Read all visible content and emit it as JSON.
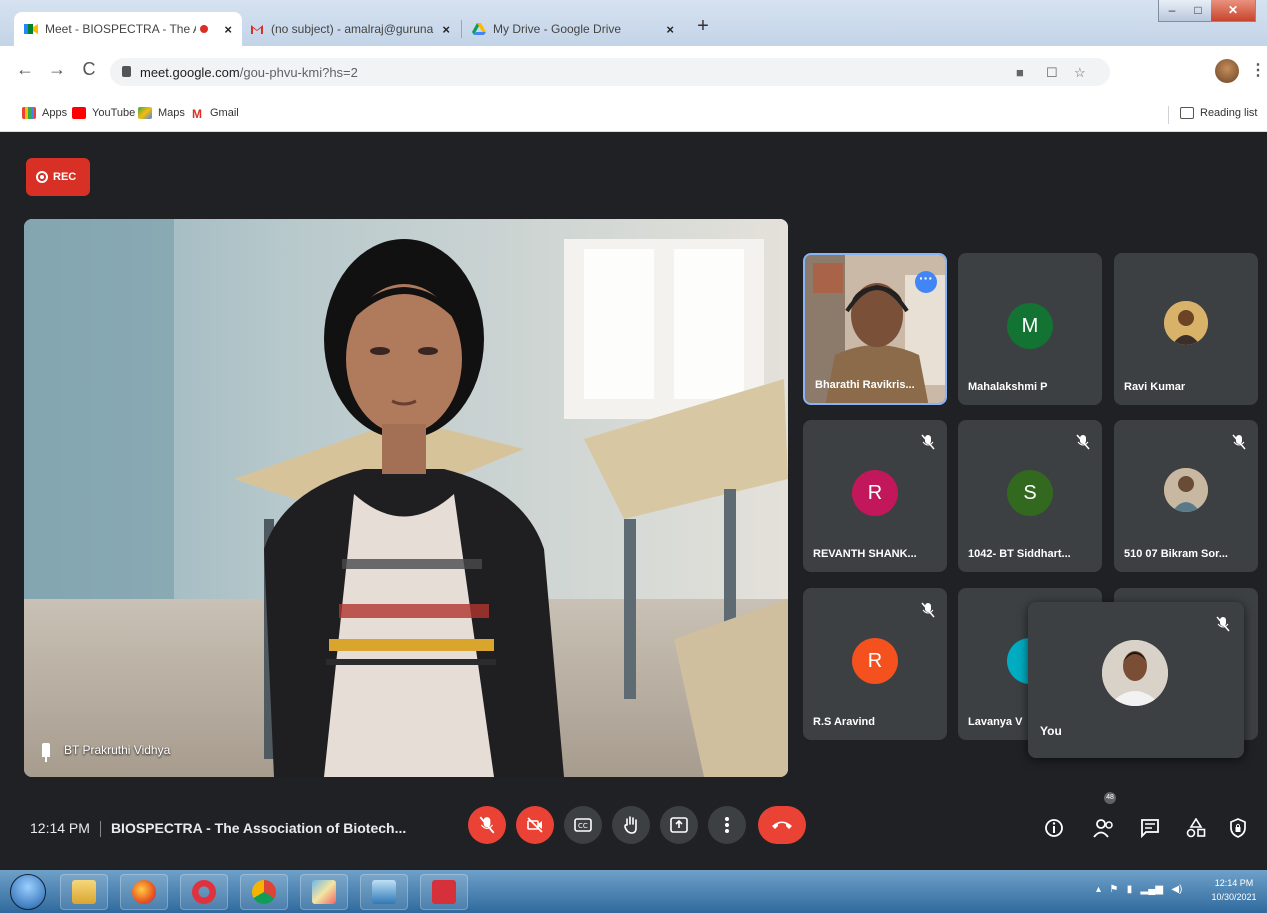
{
  "browser": {
    "tabs": [
      {
        "title": "Meet - BIOSPECTRA - The A"
      },
      {
        "title": "(no subject) - amalraj@gurunan"
      },
      {
        "title": "My Drive - Google Drive"
      }
    ],
    "address": {
      "host": "meet.google.com",
      "path": "/gou-phvu-kmi?hs=2"
    },
    "bookmarks": [
      {
        "label": "Apps"
      },
      {
        "label": "YouTube"
      },
      {
        "label": "Maps"
      },
      {
        "label": "Gmail"
      }
    ],
    "reading_list": "Reading list",
    "close_glyph": "×",
    "newtab_glyph": "+"
  },
  "meet": {
    "rec_label": "REC",
    "main_speaker": "BT Prakruthi Vidhya",
    "participants": [
      {
        "name": "Bharathi Ravikris...",
        "initial": ""
      },
      {
        "name": "Mahalakshmi P",
        "initial": "M",
        "color": "#137333"
      },
      {
        "name": "Ravi Kumar",
        "initial": ""
      },
      {
        "name": "REVANTH SHANK...",
        "initial": "R",
        "color": "#c2185b"
      },
      {
        "name": "1042- BT Siddhart...",
        "initial": "S",
        "color": "#33691e"
      },
      {
        "name": "510 07 Bikram Sor...",
        "initial": ""
      },
      {
        "name": "R.S Aravind",
        "initial": "R",
        "color": "#f4511e"
      },
      {
        "name": "Lavanya V",
        "initial": "",
        "color": "#00acc1"
      }
    ],
    "self_label": "You",
    "time": "12:14 PM",
    "meeting_title": "BIOSPECTRA - The Association of Biotech...",
    "participant_count": "48"
  },
  "taskbar": {
    "time": "12:14 PM",
    "date": "10/30/2021"
  }
}
